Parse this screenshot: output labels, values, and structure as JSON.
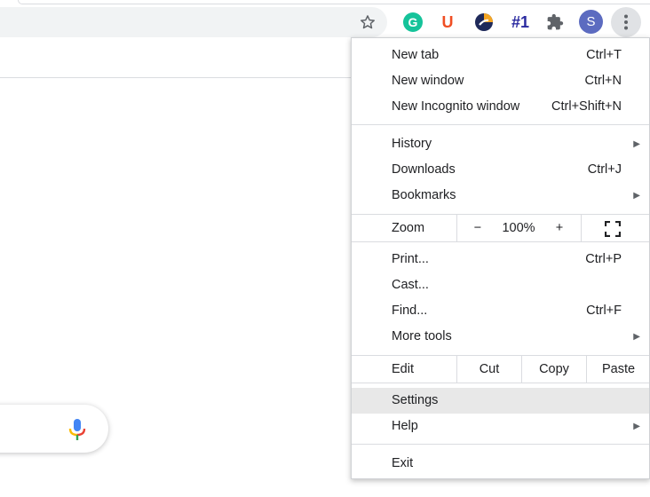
{
  "toolbar": {
    "extensions": [
      {
        "name": "grammarly",
        "glyph": "G"
      },
      {
        "name": "u-extension",
        "glyph": "U"
      },
      {
        "name": "s-extension",
        "glyph": ""
      },
      {
        "name": "hash-extension",
        "glyph": "#1"
      }
    ],
    "avatar_letter": "S"
  },
  "menu": {
    "new_tab": {
      "label": "New tab",
      "shortcut": "Ctrl+T"
    },
    "new_window": {
      "label": "New window",
      "shortcut": "Ctrl+N"
    },
    "new_incognito": {
      "label": "New Incognito window",
      "shortcut": "Ctrl+Shift+N"
    },
    "history": {
      "label": "History"
    },
    "downloads": {
      "label": "Downloads",
      "shortcut": "Ctrl+J"
    },
    "bookmarks": {
      "label": "Bookmarks"
    },
    "zoom": {
      "label": "Zoom",
      "minus": "−",
      "value": "100%",
      "plus": "+"
    },
    "print": {
      "label": "Print...",
      "shortcut": "Ctrl+P"
    },
    "cast": {
      "label": "Cast..."
    },
    "find": {
      "label": "Find...",
      "shortcut": "Ctrl+F"
    },
    "more_tools": {
      "label": "More tools"
    },
    "edit": {
      "label": "Edit",
      "cut": "Cut",
      "copy": "Copy",
      "paste": "Paste"
    },
    "settings": {
      "label": "Settings"
    },
    "help": {
      "label": "Help"
    },
    "exit": {
      "label": "Exit"
    }
  },
  "colors": {
    "menu_highlight": "#e8e8e8",
    "grammarly": "#15c39a",
    "avatar": "#5c6bc0"
  }
}
